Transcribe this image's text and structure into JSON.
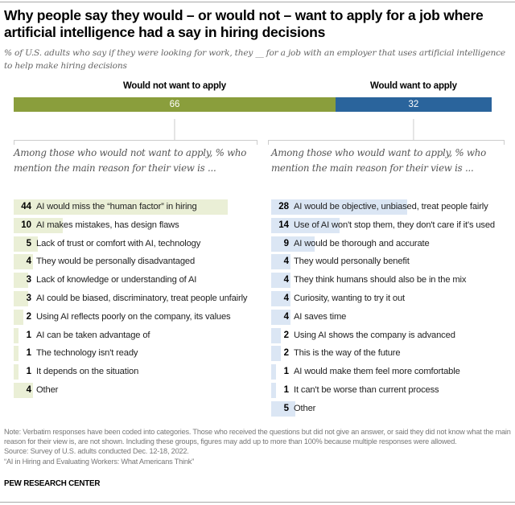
{
  "title": "Why people say they would – or would not – want to apply for a job where artificial intelligence had a say in hiring decisions",
  "subtitle": "% of U.S. adults who say if they were looking for work, they __ for a job with an employer that uses artificial intelligence to help make hiring decisions",
  "colors": {
    "would_not": "#8a9e3c",
    "would": "#2a649c",
    "left_bar_light": "#eaefd6",
    "right_bar_light": "#dbe6f4",
    "bracket": "#cccccc"
  },
  "chart_data": [
    {
      "type": "bar",
      "orientation": "horizontal-stacked",
      "title": "% of U.S. adults who say if they were looking for work, they __ for a job with an employer that uses artificial intelligence to help make hiring decisions",
      "categories": [
        "Would not want to apply",
        "Would want to apply"
      ],
      "values": [
        66,
        32
      ],
      "xlim": [
        0,
        100
      ]
    },
    {
      "type": "bar",
      "orientation": "horizontal",
      "title": "Among those who would not want to apply, % who mention the main reason for their view is ...",
      "categories": [
        "AI would miss the “human factor” in hiring",
        "AI makes mistakes, has design flaws",
        "Lack of trust or comfort with AI, technology",
        "They would be personally disadvantaged",
        "Lack of knowledge or understanding of AI",
        "AI could be biased, discriminatory, treat people unfairly",
        "Using AI reflects poorly on the company, its values",
        "AI can be taken advantage of",
        "The technology isn't ready",
        "It depends on the situation",
        "Other"
      ],
      "values": [
        44,
        10,
        5,
        4,
        3,
        3,
        2,
        1,
        1,
        1,
        4
      ]
    },
    {
      "type": "bar",
      "orientation": "horizontal",
      "title": "Among those who would want to apply, % who mention the main reason for their view is ...",
      "categories": [
        "AI would be objective, unbiased, treat people fairly",
        "Use of AI won't stop them, they don't care if it's used",
        "AI would be thorough and accurate",
        "They would personally benefit",
        "They think humans should also be in the mix",
        "Curiosity, wanting to try it out",
        "AI saves time",
        "Using AI shows the company is advanced",
        "This is the way of the future",
        "AI would make them feel more comfortable",
        "It can't be worse than current process",
        "Other"
      ],
      "values": [
        28,
        14,
        9,
        4,
        4,
        4,
        4,
        2,
        2,
        1,
        1,
        5
      ]
    }
  ],
  "left_panel": {
    "heading": "Among those who would not want to apply, % who mention the main reason for their view is ..."
  },
  "right_panel": {
    "heading": "Among those who would want to apply, % who mention the main reason for their view is ..."
  },
  "note": "Note: Verbatim responses have been coded into categories. Those who received the questions but did not give an answer, or said they did not know what the main reason for their view is, are not shown. Including these groups, figures may add up to more than 100% because multiple responses were allowed.",
  "source": "Source: Survey of U.S. adults conducted Dec. 12-18, 2022.",
  "report": "“AI in Hiring and Evaluating Workers: What Americans Think”",
  "brand": "PEW RESEARCH CENTER"
}
